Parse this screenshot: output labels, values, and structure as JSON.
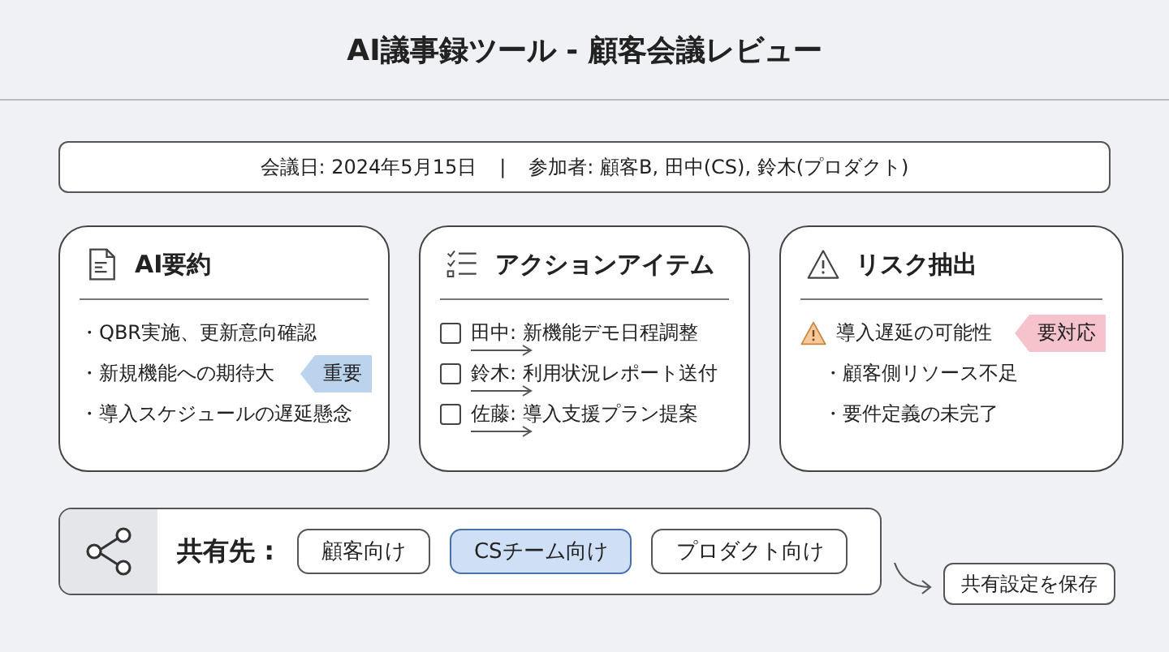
{
  "title": "AI議事録ツール - 顧客会議レビュー",
  "meeting_info": {
    "date": "会議日: 2024年5月15日",
    "separator": "|",
    "participants": "参加者: 顧客B, 田中(CS), 鈴木(プロダクト)"
  },
  "cards": [
    {
      "kind": "summary",
      "title": "AI要約",
      "items": [
        {
          "text": "・QBR実施、更新意向確認"
        },
        {
          "text": "・新規機能への期待大",
          "badge": {
            "label": "重要",
            "color": "#bcd3ee"
          }
        },
        {
          "text": "・導入スケジュールの遅延懸念"
        }
      ]
    },
    {
      "kind": "actions",
      "title": "アクションアイテム",
      "items": [
        {
          "text": "田中: 新機能デモ日程調整",
          "checked": false
        },
        {
          "text": "鈴木: 利用状況レポート送付",
          "checked": false
        },
        {
          "text": "佐藤: 導入支援プラン提案",
          "checked": false
        }
      ]
    },
    {
      "kind": "risks",
      "title": "リスク抽出",
      "items": [
        {
          "text": "導入遅延の可能性",
          "badge": {
            "label": "要対応",
            "color": "#f6c3cc"
          },
          "children": [
            {
              "text": "・顧客側リソース不足"
            },
            {
              "text": "・要件定義の未完了"
            }
          ]
        }
      ]
    }
  ],
  "share": {
    "label": "共有先 :",
    "options": [
      {
        "label": "顧客向け",
        "selected": false
      },
      {
        "label": "CSチーム向け",
        "selected": true
      },
      {
        "label": "プロダクト向け",
        "selected": false
      }
    ]
  },
  "save_button": "共有設定を保存"
}
